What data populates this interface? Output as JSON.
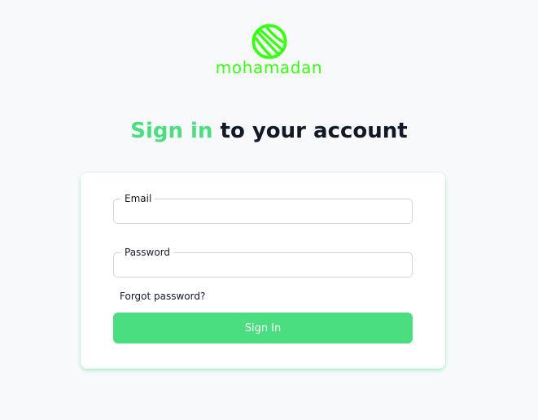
{
  "brand": {
    "name": "mohamadan",
    "logo_icon": "basketball-icon",
    "color": "#39ff14"
  },
  "heading": {
    "accent": "Sign in",
    "rest": " to your account"
  },
  "form": {
    "email_label": "Email",
    "email_value": "",
    "password_label": "Password",
    "password_value": "",
    "forgot_password": "Forgot password?",
    "submit_label": "Sign In"
  },
  "colors": {
    "accent": "#4ade80",
    "text": "#111827",
    "background": "#f8f9fb"
  }
}
